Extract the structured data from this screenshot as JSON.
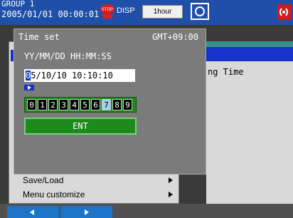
{
  "status_bar": {
    "group": "GROUP 1",
    "datetime": "2005/01/01 00:00:01",
    "disp_label": "DISP",
    "period": "1hour"
  },
  "dialog": {
    "title": "Time set",
    "timezone": "GMT+09:00",
    "format": "YY/MM/DD  HH:MM:SS",
    "value_first_char": "0",
    "value_rest": "5/10/10 10:10:10",
    "digits": [
      "0",
      "1",
      "2",
      "3",
      "4",
      "5",
      "6",
      "7",
      "8",
      "9"
    ],
    "selected_digit": "7",
    "ent_label": "ENT"
  },
  "menu": {
    "visible_partial_text": "ng Time",
    "items": [
      {
        "label": "Save/Load"
      },
      {
        "label": "Menu customize"
      }
    ]
  },
  "colors": {
    "topbar": "#1f4fa8",
    "dialog": "#7b7b7b",
    "accent_blue": "#1533c8",
    "key_green": "#1d8a1d"
  },
  "icons": [
    "stop-icon",
    "camera-icon",
    "alarm-icon",
    "arrow-left-icon",
    "arrow-right-icon"
  ]
}
